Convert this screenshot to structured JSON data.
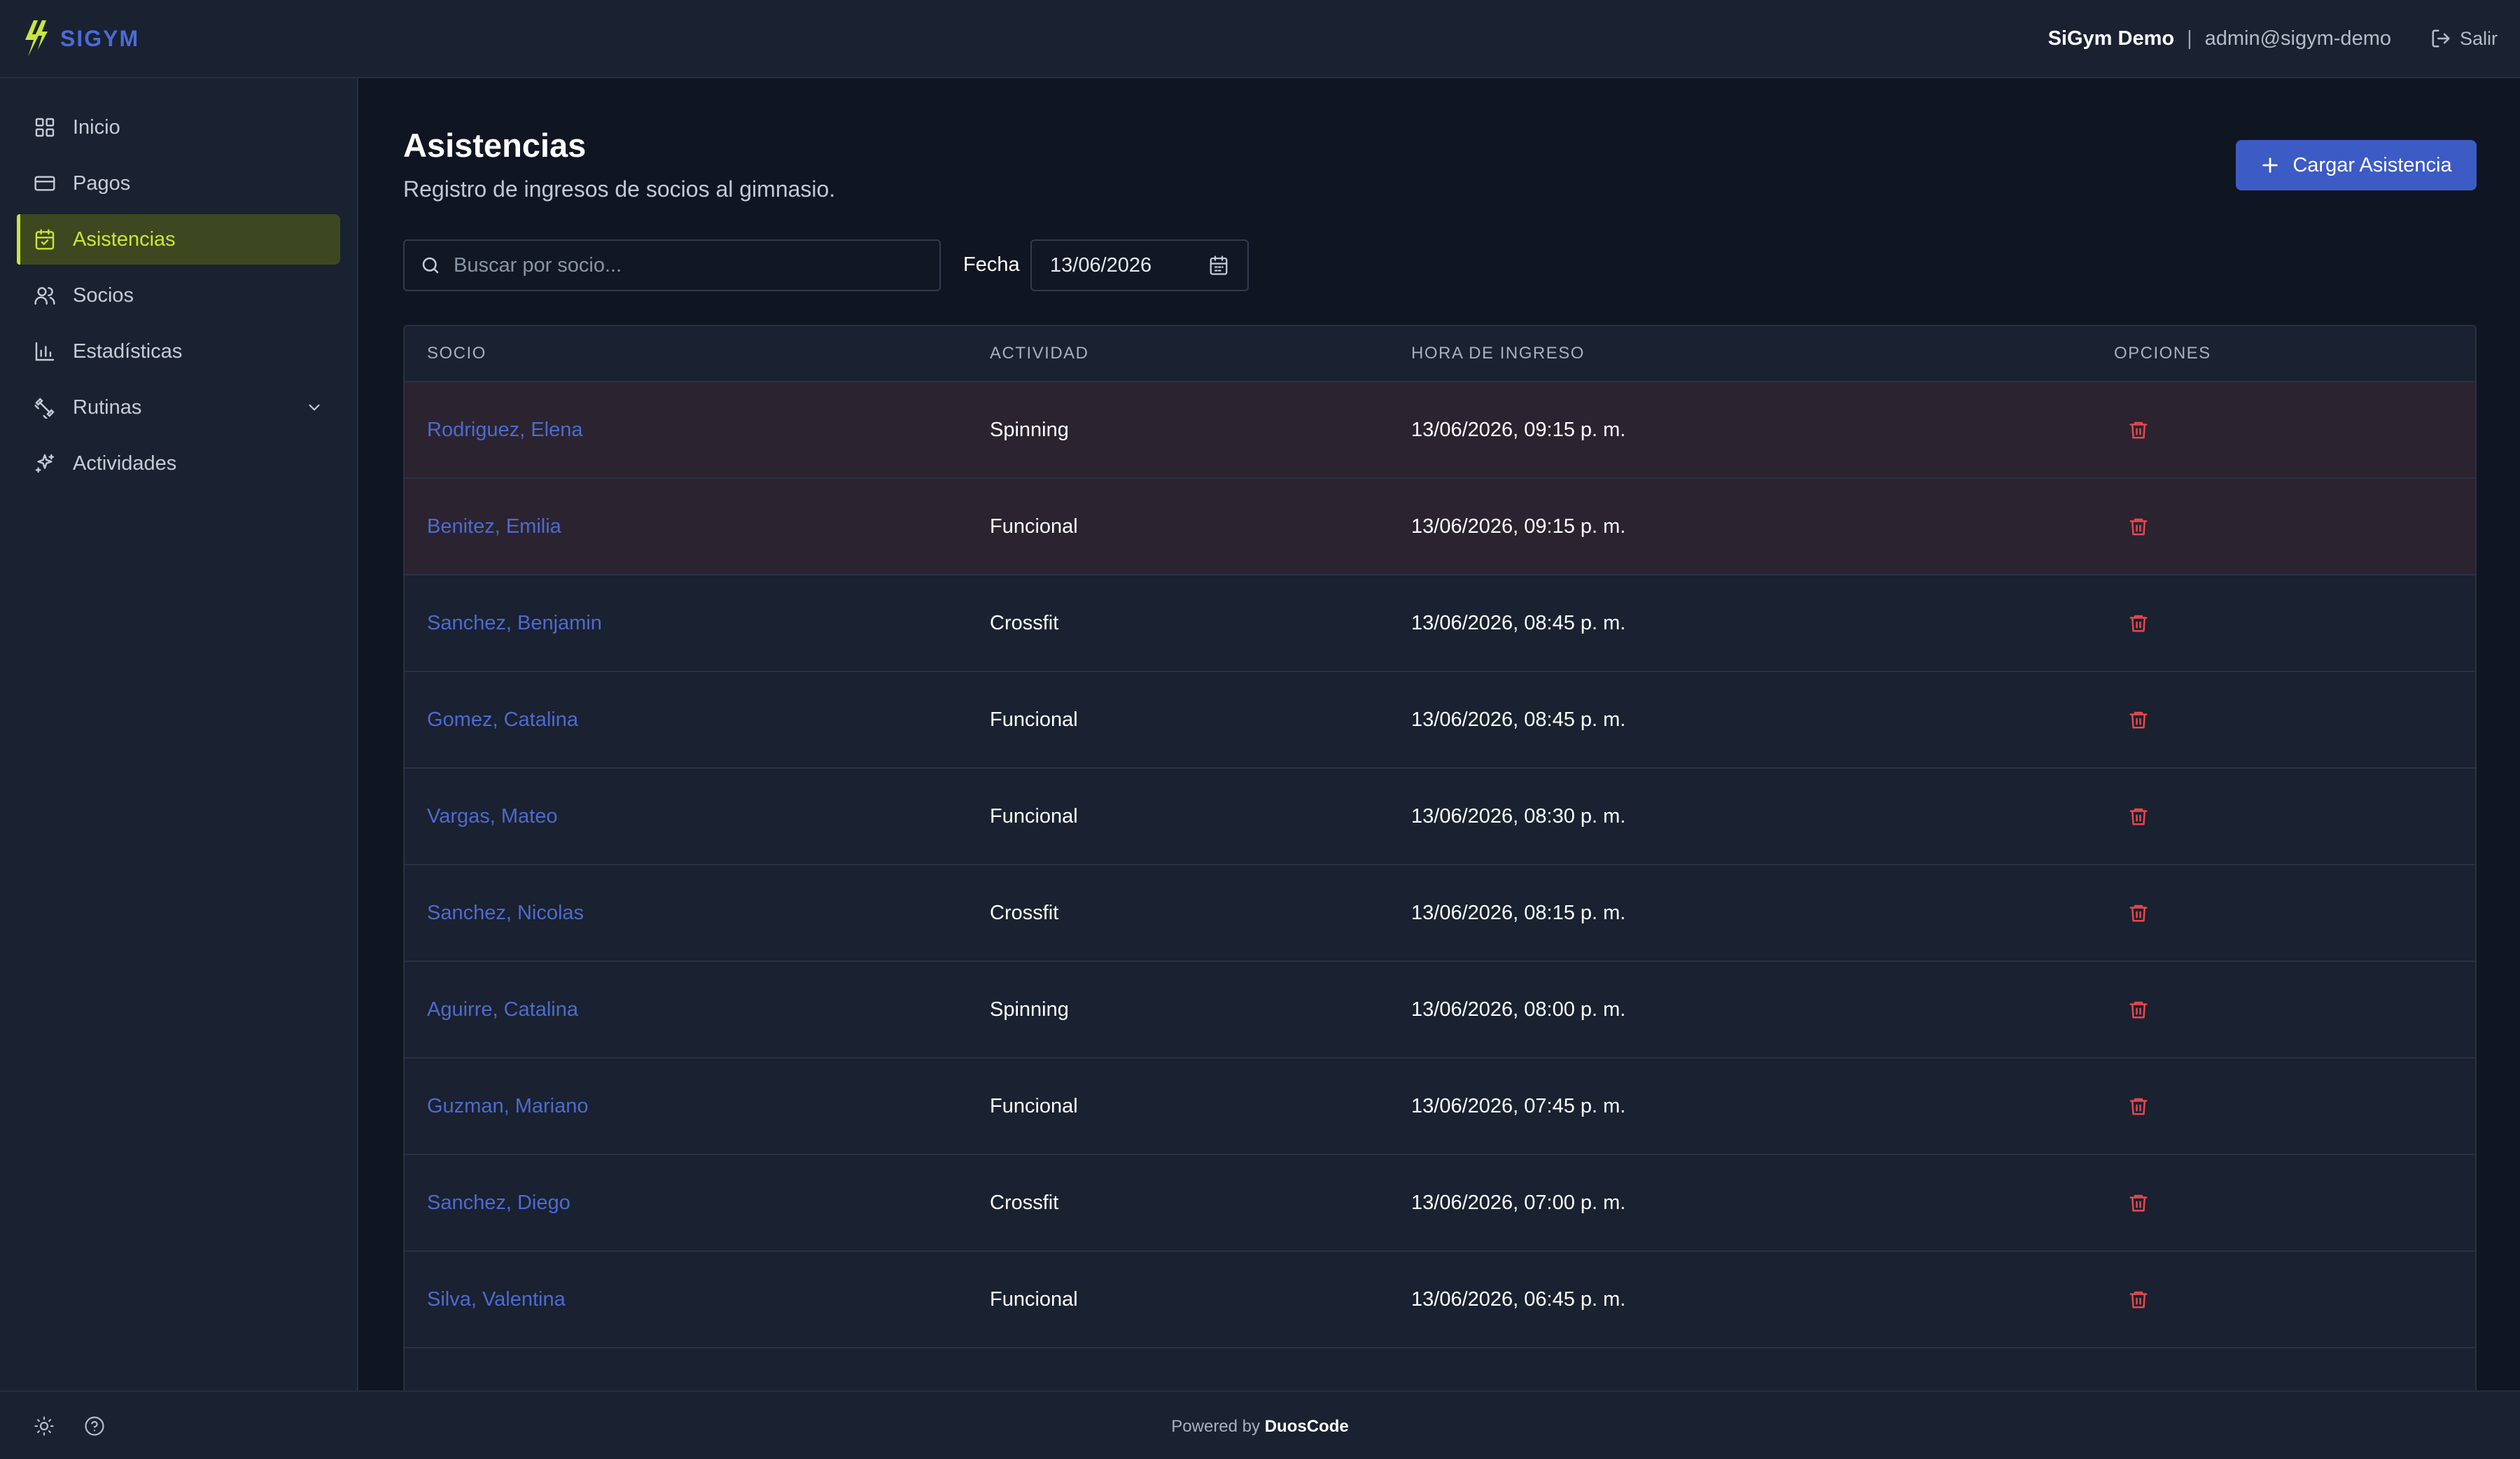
{
  "app": {
    "brand": "SIGYM"
  },
  "header": {
    "org_name": "SiGym Demo",
    "separator": "|",
    "user_email": "admin@sigym-demo",
    "logout_label": "Salir"
  },
  "sidebar": {
    "items": [
      {
        "label": "Inicio",
        "icon": "grid-icon",
        "active": false
      },
      {
        "label": "Pagos",
        "icon": "credit-card-icon",
        "active": false
      },
      {
        "label": "Asistencias",
        "icon": "calendar-check-icon",
        "active": true
      },
      {
        "label": "Socios",
        "icon": "users-icon",
        "active": false
      },
      {
        "label": "Estadísticas",
        "icon": "bar-chart-icon",
        "active": false
      },
      {
        "label": "Rutinas",
        "icon": "dumbbell-icon",
        "active": false,
        "expandable": true
      },
      {
        "label": "Actividades",
        "icon": "sparkle-icon",
        "active": false
      }
    ]
  },
  "page": {
    "title": "Asistencias",
    "subtitle": "Registro de ingresos de socios al gimnasio.",
    "primary_action": "Cargar Asistencia"
  },
  "filters": {
    "search_placeholder": "Buscar por socio...",
    "search_value": "",
    "date_label": "Fecha",
    "date_value": "13/06/2026"
  },
  "table": {
    "columns": [
      "SOCIO",
      "ACTIVIDAD",
      "HORA DE INGRESO",
      "OPCIONES"
    ],
    "rows": [
      {
        "socio": "Rodriguez, Elena",
        "actividad": "Spinning",
        "hora": "13/06/2026, 09:15 p. m.",
        "highlight": true
      },
      {
        "socio": "Benitez, Emilia",
        "actividad": "Funcional",
        "hora": "13/06/2026, 09:15 p. m.",
        "highlight": true
      },
      {
        "socio": "Sanchez, Benjamin",
        "actividad": "Crossfit",
        "hora": "13/06/2026, 08:45 p. m.",
        "highlight": false
      },
      {
        "socio": "Gomez, Catalina",
        "actividad": "Funcional",
        "hora": "13/06/2026, 08:45 p. m.",
        "highlight": false
      },
      {
        "socio": "Vargas, Mateo",
        "actividad": "Funcional",
        "hora": "13/06/2026, 08:30 p. m.",
        "highlight": false
      },
      {
        "socio": "Sanchez, Nicolas",
        "actividad": "Crossfit",
        "hora": "13/06/2026, 08:15 p. m.",
        "highlight": false
      },
      {
        "socio": "Aguirre, Catalina",
        "actividad": "Spinning",
        "hora": "13/06/2026, 08:00 p. m.",
        "highlight": false
      },
      {
        "socio": "Guzman, Mariano",
        "actividad": "Funcional",
        "hora": "13/06/2026, 07:45 p. m.",
        "highlight": false
      },
      {
        "socio": "Sanchez, Diego",
        "actividad": "Crossfit",
        "hora": "13/06/2026, 07:00 p. m.",
        "highlight": false
      },
      {
        "socio": "Silva, Valentina",
        "actividad": "Funcional",
        "hora": "13/06/2026, 06:45 p. m.",
        "highlight": false
      }
    ]
  },
  "footer": {
    "powered_prefix": "Powered by",
    "powered_brand": "DuosCode"
  },
  "colors": {
    "accent": "#c8e63c",
    "primary": "#3d5bc4",
    "link": "#4d6bcf",
    "danger": "#e5484d"
  }
}
